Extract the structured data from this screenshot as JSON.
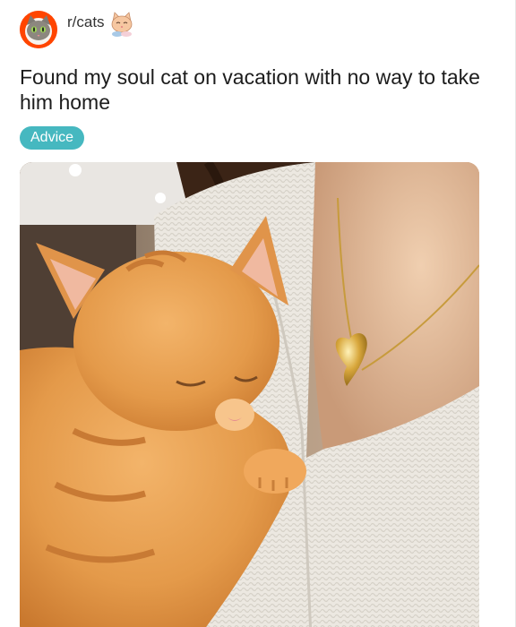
{
  "post": {
    "subreddit": "r/cats",
    "title": "Found my soul cat on vacation with no way to take him home",
    "flair": "Advice",
    "flair_color": "#46b8c0"
  },
  "icons": {
    "avatar": "cat-avatar-icon",
    "sticker": "cat-sticker-icon"
  },
  "photo": {
    "subject": "sleeping orange kitten on white knit sweater with gold heart necklace"
  }
}
